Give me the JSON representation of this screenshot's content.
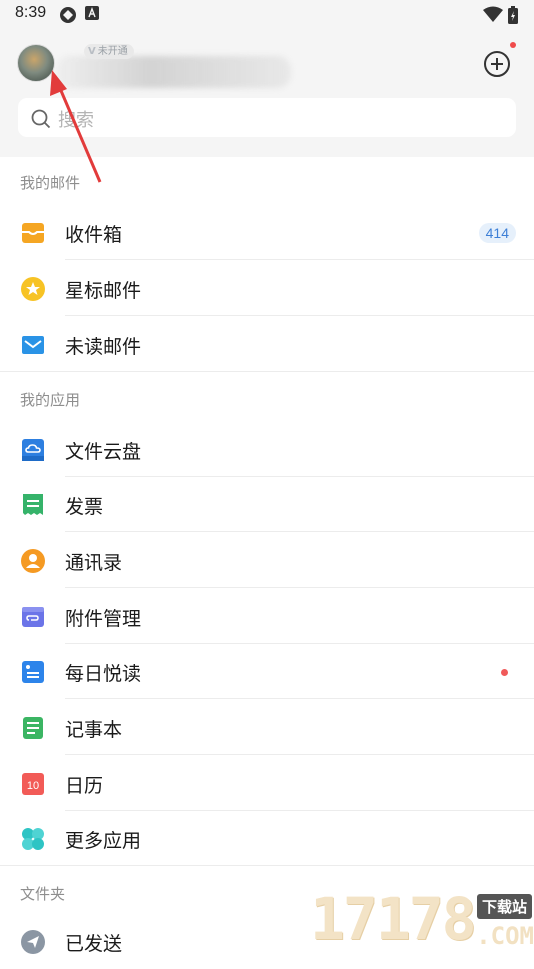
{
  "status_bar": {
    "time": "8:39"
  },
  "header": {
    "vip_badge": "未开通"
  },
  "search": {
    "placeholder": "搜索"
  },
  "sections": {
    "mail": "我的邮件",
    "apps": "我的应用",
    "folders": "文件夹"
  },
  "mail_items": [
    {
      "label": "收件箱",
      "badge": "414",
      "icon": "inbox-icon",
      "color": "#f5a623"
    },
    {
      "label": "星标邮件",
      "icon": "star-icon",
      "color": "#f7c325"
    },
    {
      "label": "未读邮件",
      "icon": "envelope-icon",
      "color": "#2a93e6"
    }
  ],
  "app_items": [
    {
      "label": "文件云盘",
      "icon": "cloud-drive-icon",
      "color": "#2d7fe0"
    },
    {
      "label": "发票",
      "icon": "invoice-icon",
      "color": "#35b36a"
    },
    {
      "label": "通讯录",
      "icon": "contacts-icon",
      "color": "#f59a23"
    },
    {
      "label": "附件管理",
      "icon": "attachment-icon",
      "color": "#6b74e8"
    },
    {
      "label": "每日悦读",
      "icon": "reading-icon",
      "color": "#2d84ea"
    },
    {
      "label": "记事本",
      "icon": "notebook-icon",
      "color": "#3bb563"
    },
    {
      "label": "日历",
      "icon": "calendar-icon",
      "calendar_day": "10",
      "color": "#f25b57"
    },
    {
      "label": "更多应用",
      "icon": "more-apps-icon",
      "color": "#2ec4c4"
    }
  ],
  "folder_items": [
    {
      "label": "已发送",
      "icon": "sent-icon",
      "color": "#8b96a3"
    }
  ],
  "watermark": {
    "number": "17178",
    "tag": "下载站",
    "domain": ".COM"
  }
}
